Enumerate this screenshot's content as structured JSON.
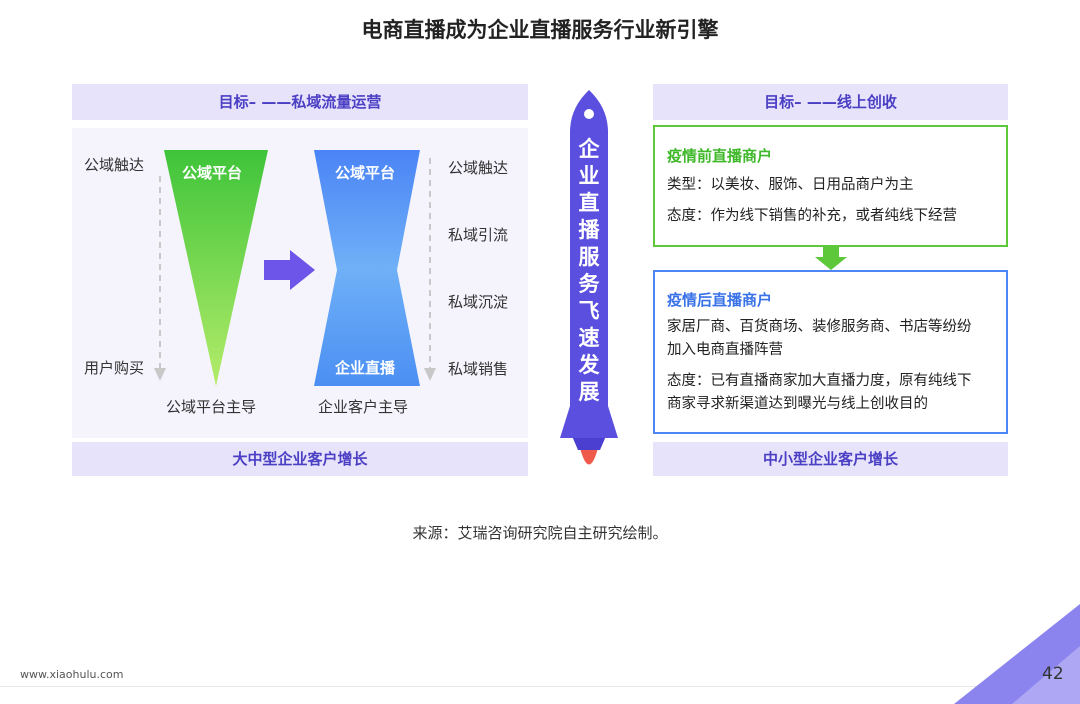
{
  "title": "电商直播成为企业直播服务行业新引擎",
  "left": {
    "header": "目标– ——私域流量运营",
    "footer": "大中型企业客户增长",
    "funnel1": {
      "top_label": "公域平台",
      "side_top": "公域触达",
      "side_bottom": "用户购买",
      "caption": "公域平台主导"
    },
    "funnel2": {
      "top_label": "公域平台",
      "bottom_label": "企业直播",
      "caption": "企业客户主导",
      "stages": [
        "公域触达",
        "私域引流",
        "私域沉淀",
        "私域销售"
      ]
    }
  },
  "rocket": {
    "text": [
      "企",
      "业",
      "直",
      "播",
      "服",
      "务",
      "飞",
      "速",
      "发",
      "展"
    ]
  },
  "right": {
    "header": "目标– ——线上创收",
    "footer": "中小型企业客户增长",
    "box1": {
      "title": "疫情前直播商户",
      "line1": "类型：以美妆、服饰、日用品商户为主",
      "line2": "态度：作为线下销售的补充，或者纯线下经营"
    },
    "box2": {
      "title": "疫情后直播商户",
      "line1": "家居厂商、百货商场、装修服务商、书店等纷纷",
      "line2": "加入电商直播阵营",
      "line3": "态度：已有直播商家加大直播力度，原有纯线下",
      "line4": "商家寻求新渠道达到曝光与线上创收目的"
    }
  },
  "source": "来源：艾瑞咨询研究院自主研究绘制。",
  "footer": {
    "url": "www.xiaohulu.com",
    "page": "42"
  },
  "colors": {
    "accent_purple": "#5b4fe0",
    "band_bg": "#e6e3fb",
    "green": "#5cc83a",
    "blue": "#4f86f7"
  }
}
